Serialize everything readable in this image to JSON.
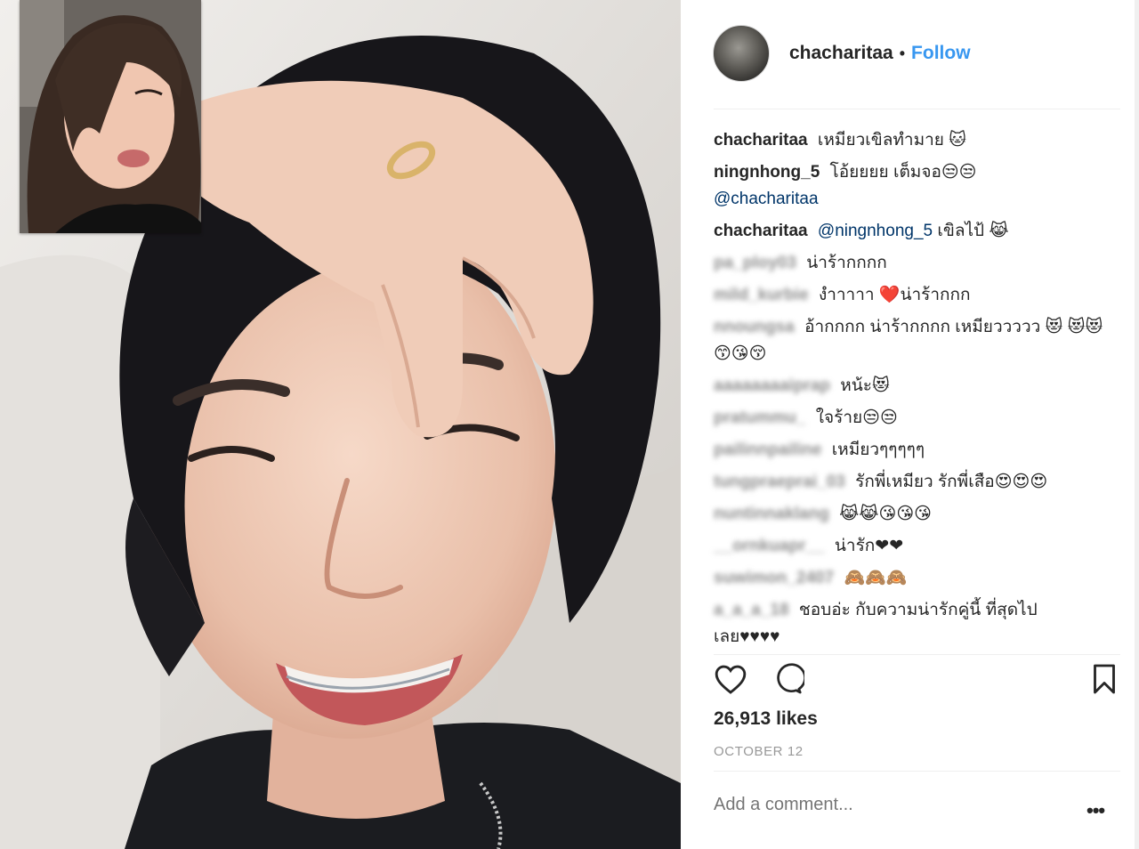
{
  "post": {
    "username": "chacharitaa",
    "separator": "•",
    "follow_label": "Follow",
    "likes": "26,913 likes",
    "date": "OCTOBER 12",
    "add_comment_placeholder": "Add a comment...",
    "more_label": "•••"
  },
  "comments": [
    {
      "user": "chacharitaa",
      "text": "เหมียวเขิลทำมาย 🐱",
      "blurred": false
    },
    {
      "user": "ningnhong_5",
      "text": "โอ้ยยยย เต็มจอ😒😒",
      "mention": "@chacharitaa",
      "blurred": false
    },
    {
      "user": "chacharitaa",
      "mention": "@ningnhong_5",
      "text": "เขิลไป้ 😹",
      "blurred": false
    },
    {
      "user": "pa_ploy03",
      "text": "น่าร้ากกกก",
      "blurred": true
    },
    {
      "user": "mild_kurbie",
      "text": "งำาาาา ❤️น่าร้ากกก",
      "blurred": true
    },
    {
      "user": "nnoungsa",
      "text": "อ้ากกกก น่าร้ากกกก เหมียววววว 😻 😻😻😙😘😚",
      "blurred": true
    },
    {
      "user": "aaaaaaaaiprap",
      "text": "หน้ะ😻",
      "blurred": true
    },
    {
      "user": "pratummu_",
      "text": "ใจร้าย😒😒",
      "blurred": true
    },
    {
      "user": "pailinnpailine",
      "text": "เหมียวๆๆๆๆๆ",
      "blurred": true
    },
    {
      "user": "tungpraeprai_03",
      "text": "รักพี่เหมียว รักพี่เสือ😍😍😍",
      "blurred": true
    },
    {
      "user": "nuntinnaklang",
      "text": "😹😹😘😘😘",
      "blurred": true
    },
    {
      "user": "__ornkuapr__",
      "text": "น่ารัก❤❤",
      "blurred": true
    },
    {
      "user": "suwimon_2407",
      "text": "🙈🙈🙈",
      "blurred": true
    },
    {
      "user": "a_a_a_18",
      "text": "ชอบอ่ะ กับความน่ารักคู่นี้ ที่สุดไป เลย♥♥♥♥",
      "blurred": true
    }
  ],
  "icons": {
    "like": "heart-icon",
    "comment": "comment-icon",
    "save": "bookmark-icon",
    "more": "more-icon"
  },
  "colors": {
    "follow": "#3897f0",
    "text": "#262626",
    "muted": "#999999",
    "divider": "#efefef"
  }
}
